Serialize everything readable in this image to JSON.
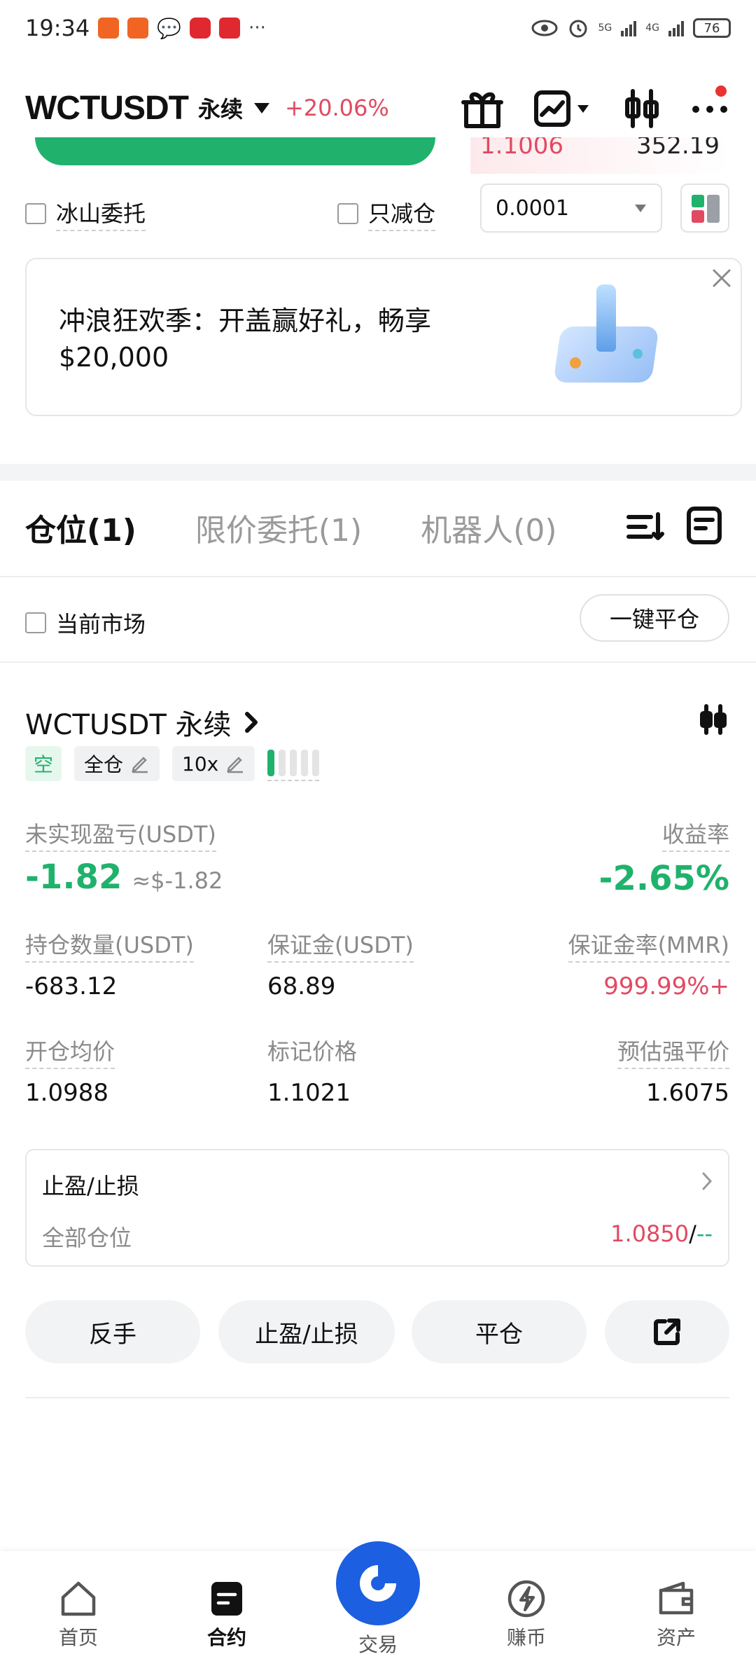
{
  "status_bar": {
    "time": "19:34",
    "more": "···",
    "network_1": "5G",
    "network_2": "4G",
    "battery": "76"
  },
  "header": {
    "symbol": "WCTUSDT",
    "type": "永续",
    "change": "+20.06%"
  },
  "order_panel": {
    "price_peek": "1.1006",
    "qty_peek": "352.19",
    "iceberg_label": "冰山委托",
    "reduce_only_label": "只减仓",
    "precision_value": "0.0001"
  },
  "banner": {
    "text": "冲浪狂欢季：开盖赢好礼，畅享 $20,000"
  },
  "tabs": {
    "items": [
      {
        "label": "仓位(1)"
      },
      {
        "label": "限价委托(1)"
      },
      {
        "label": "机器人(0)"
      }
    ]
  },
  "filter": {
    "current_market_label": "当前市场",
    "close_all_label": "一键平仓"
  },
  "position": {
    "title": "WCTUSDT 永续",
    "side_badge": "空",
    "margin_mode": "全仓",
    "leverage": "10x",
    "pnl_label": "未实现盈亏(USDT)",
    "pnl_value": "-1.82",
    "pnl_usd": "≈$-1.82",
    "roe_label": "收益率",
    "roe_value": "-2.65%",
    "size_label": "持仓数量(USDT)",
    "size_value": "-683.12",
    "margin_label": "保证金(USDT)",
    "margin_value": "68.89",
    "mmr_label": "保证金率(MMR)",
    "mmr_value": "999.99%+",
    "entry_label": "开仓均价",
    "entry_value": "1.0988",
    "mark_label": "标记价格",
    "mark_value": "1.1021",
    "liq_label": "预估强平价",
    "liq_value": "1.6075",
    "tpsl_title": "止盈/止损",
    "tpsl_scope": "全部仓位",
    "tp_value": "1.0850",
    "tpsl_sep": "/",
    "sl_value": "--"
  },
  "actions": {
    "reverse": "反手",
    "tpsl": "止盈/止损",
    "close": "平仓"
  },
  "bottom_nav": {
    "home": "首页",
    "contract": "合约",
    "trade": "交易",
    "earn": "赚币",
    "assets": "资产"
  },
  "colors": {
    "green": "#20b26c",
    "red": "#e04a63",
    "blue_fab": "#1c5fe0"
  }
}
